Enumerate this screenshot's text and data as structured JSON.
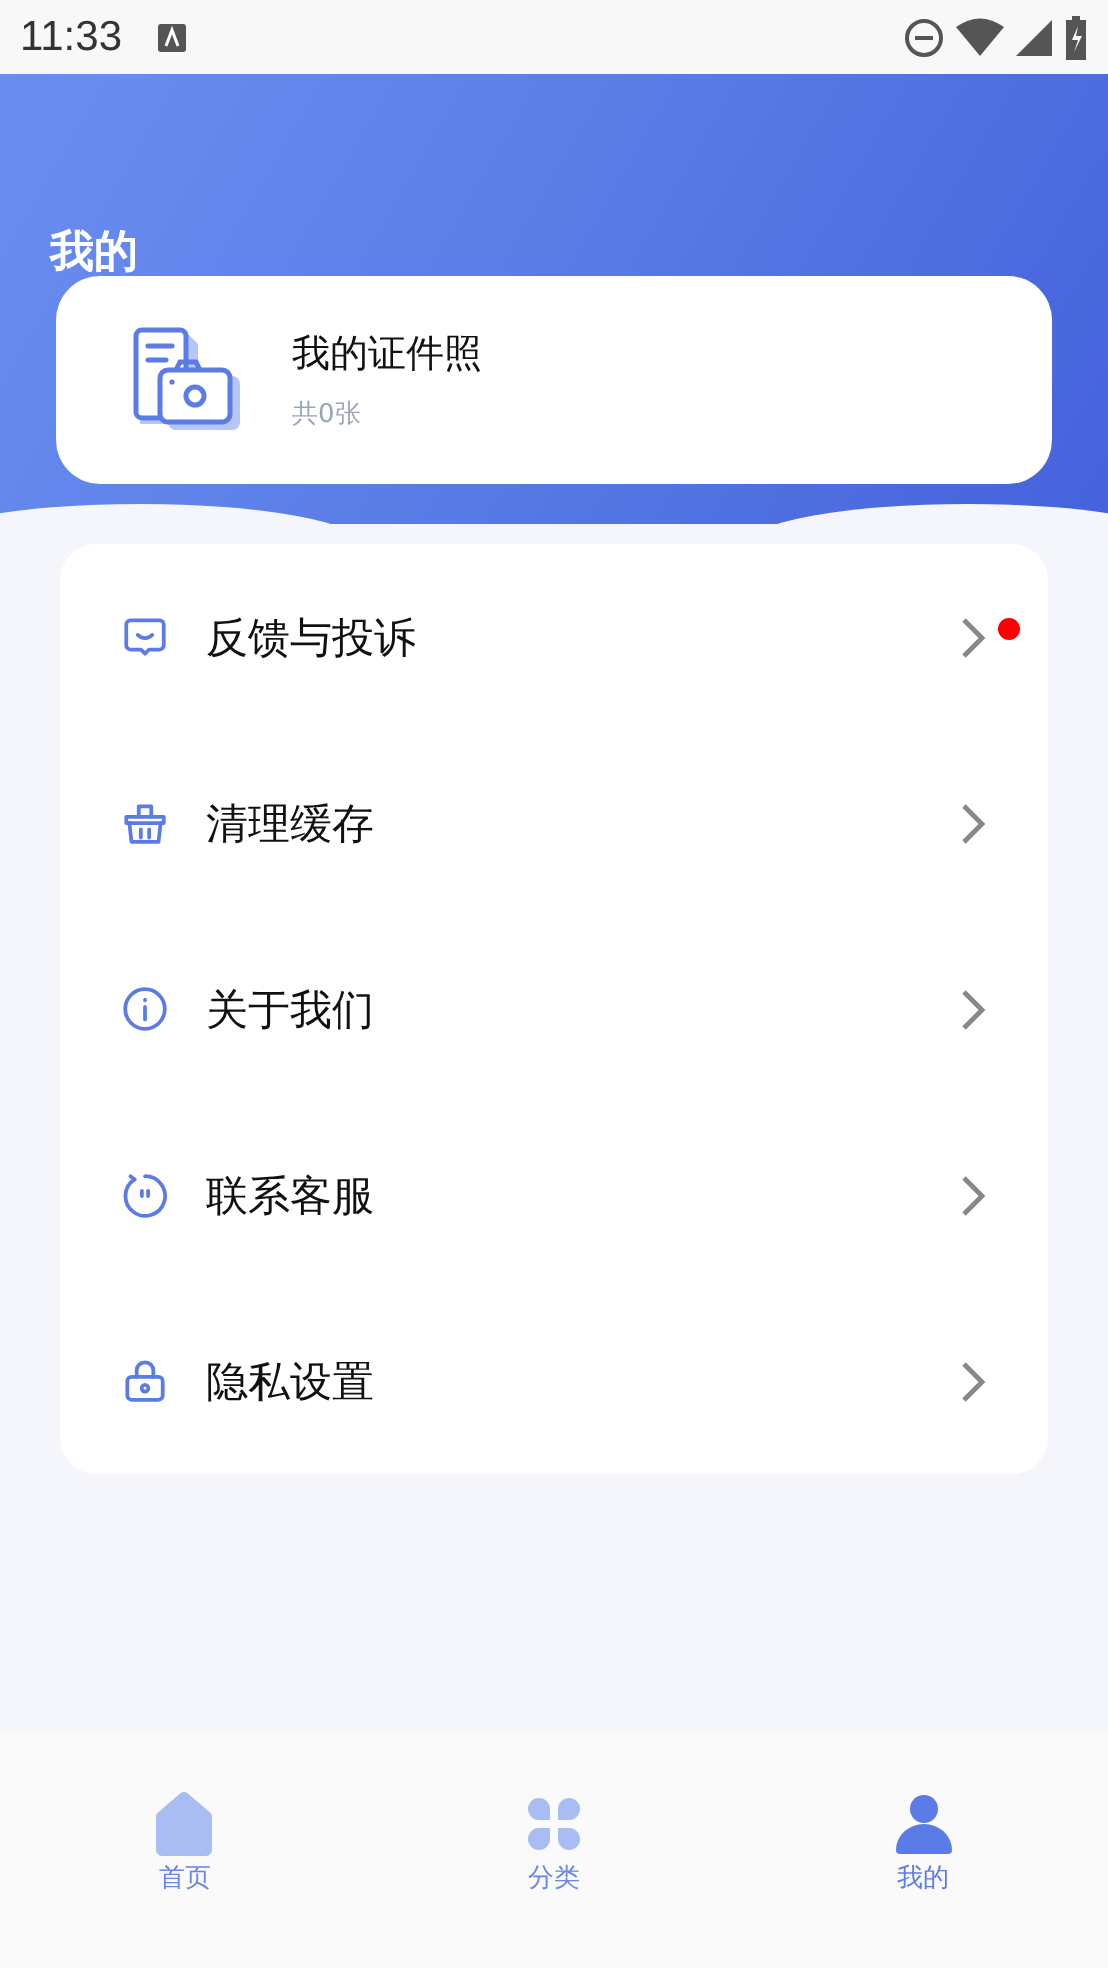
{
  "status_bar": {
    "time": "11:33"
  },
  "header": {
    "title": "我的"
  },
  "photo_card": {
    "title": "我的证件照",
    "count": "共0张"
  },
  "menu": [
    {
      "label": "反馈与投诉",
      "has_badge": true
    },
    {
      "label": "清理缓存",
      "has_badge": false
    },
    {
      "label": "关于我们",
      "has_badge": false
    },
    {
      "label": "联系客服",
      "has_badge": false
    },
    {
      "label": "隐私设置",
      "has_badge": false
    }
  ],
  "tab_bar": [
    {
      "label": "首页",
      "selected": false
    },
    {
      "label": "分类",
      "selected": false
    },
    {
      "label": "我的",
      "selected": true
    }
  ]
}
